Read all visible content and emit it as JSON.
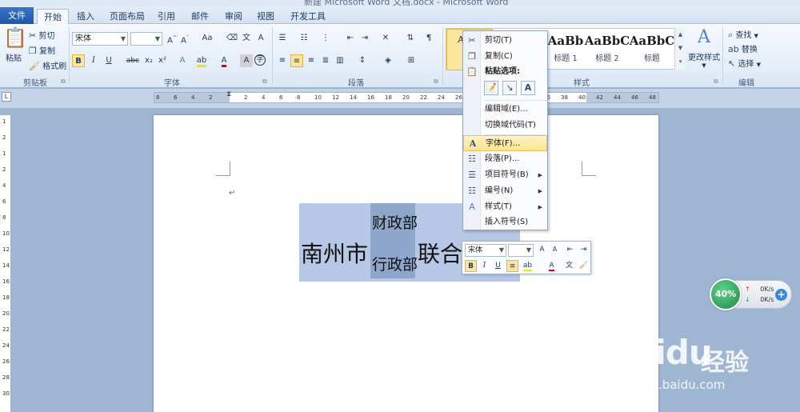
{
  "window": {
    "title": "新建 Microsoft Word 文档.docx - Microsoft Word"
  },
  "tabs": {
    "file": "文件",
    "items": [
      "开始",
      "插入",
      "页面布局",
      "引用",
      "邮件",
      "审阅",
      "视图",
      "开发工具"
    ],
    "active": "开始"
  },
  "ribbon": {
    "clipboard": {
      "label": "剪贴板",
      "paste": "粘贴",
      "cut": "剪切",
      "copy": "复制",
      "format_painter": "格式刷"
    },
    "font": {
      "label": "字体",
      "font_name": "宋体",
      "font_size": "",
      "change_case": "Aa"
    },
    "paragraph": {
      "label": "段落"
    },
    "styles": {
      "label": "样式",
      "items": [
        {
          "sample": "AaBb",
          "caption": ""
        },
        {
          "sample": "AaBb",
          "caption": "标题 1"
        },
        {
          "sample": "AaBbC",
          "caption": "标题 2"
        },
        {
          "sample": "AaBbC",
          "caption": "标题"
        }
      ],
      "change_styles": "更改样式"
    },
    "editing": {
      "label": "编辑",
      "find": "查找",
      "replace": "替换",
      "select": "选择"
    }
  },
  "ruler": {
    "horizontal": [
      "8",
      "6",
      "4",
      "2",
      "",
      "2",
      "4",
      "6",
      "8",
      "10",
      "12",
      "14",
      "16",
      "18",
      "20",
      "22",
      "24",
      "26",
      "28",
      "30",
      "32",
      "34",
      "36",
      "38",
      "40",
      "42",
      "44",
      "46",
      "48"
    ],
    "vertical": [
      "1",
      "2",
      "1",
      "2",
      "4",
      "6",
      "8",
      "10",
      "12",
      "14",
      "16",
      "18",
      "20",
      "22",
      "24",
      "26",
      "28",
      "30"
    ],
    "corner": "L"
  },
  "document": {
    "left_text": "南州市",
    "top_stack": "财政部",
    "bottom_stack": "行政部",
    "right_text": "联合",
    "paragraph_mark": "↵"
  },
  "context_menu": {
    "cut": "剪切(T)",
    "copy": "复制(C)",
    "paste_options": "粘贴选项:",
    "edit_field": "编辑域(E)...",
    "toggle_field_codes": "切换域代码(T)",
    "font": "字体(F)...",
    "paragraph": "段落(P)...",
    "bullets": "项目符号(B)",
    "numbering": "编号(N)",
    "styles": "样式(T)",
    "insert_symbol": "插入符号(S)"
  },
  "mini_toolbar": {
    "font_name": "宋体",
    "font_size": ""
  },
  "network_widget": {
    "percent": "40%",
    "up": "0K/s",
    "down": "0K/s"
  },
  "watermark": {
    "logo": "Baidu",
    "name": "经验",
    "url": "jingyan.baidu.com"
  }
}
